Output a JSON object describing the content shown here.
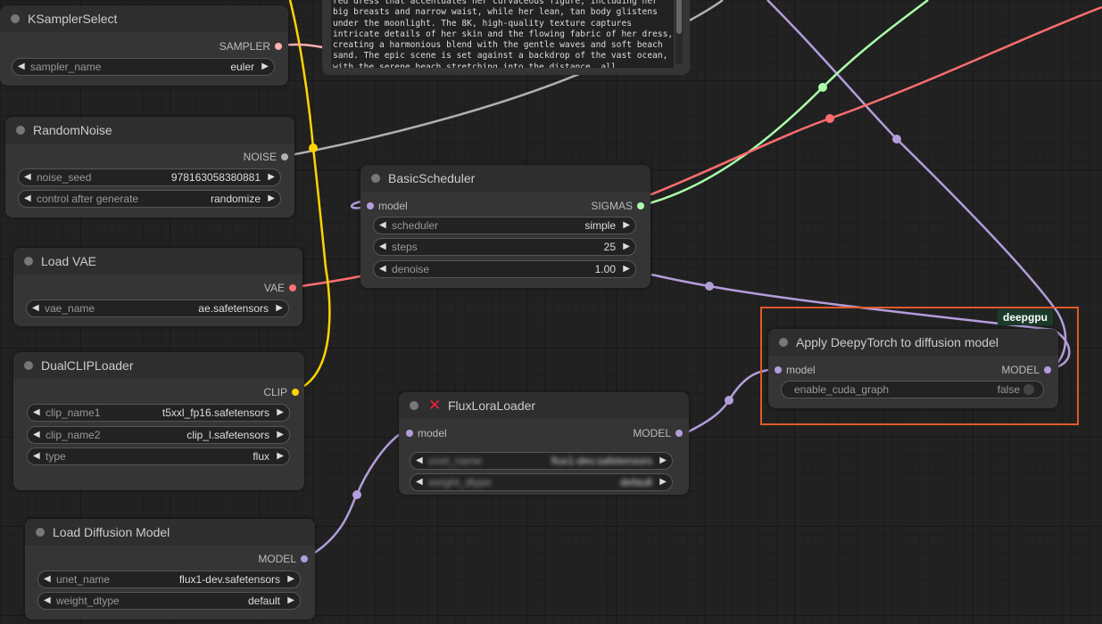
{
  "prompt_text": "red dress that accentuates her curvaceous figure, including her big breasts and narrow waist, while her lean, tan body glistens under the moonlight. The 8K, high-quality texture captures intricate details of her skin and the flowing fabric of her dress, creating a harmonious blend with the gentle waves and soft beach sand. The epic scene is set against a backdrop of the vast ocean, with the serene beach stretching into the distance, all",
  "colors": {
    "clip": "#ffd500",
    "vae": "#ff6e6e",
    "model": "#b39ddb",
    "sigmas": "#aaffaa",
    "noise": "#b0b0b0",
    "sampler": "#ffb0b0",
    "highlight": "#e05a2b"
  },
  "badge": "deepgpu",
  "nodes": {
    "ksampler_select": {
      "title": "KSamplerSelect",
      "output": "SAMPLER",
      "widgets": [
        {
          "label": "sampler_name",
          "value": "euler"
        }
      ]
    },
    "random_noise": {
      "title": "RandomNoise",
      "output": "NOISE",
      "widgets": [
        {
          "label": "noise_seed",
          "value": "978163058380881"
        },
        {
          "label": "control after generate",
          "value": "randomize"
        }
      ]
    },
    "load_vae": {
      "title": "Load VAE",
      "output": "VAE",
      "widgets": [
        {
          "label": "vae_name",
          "value": "ae.safetensors"
        }
      ]
    },
    "dual_clip_loader": {
      "title": "DualCLIPLoader",
      "output": "CLIP",
      "widgets": [
        {
          "label": "clip_name1",
          "value": "t5xxl_fp16.safetensors"
        },
        {
          "label": "clip_name2",
          "value": "clip_l.safetensors"
        },
        {
          "label": "type",
          "value": "flux"
        }
      ]
    },
    "load_diffusion_model": {
      "title": "Load Diffusion Model",
      "output": "MODEL",
      "widgets": [
        {
          "label": "unet_name",
          "value": "flux1-dev.safetensors"
        },
        {
          "label": "weight_dtype",
          "value": "default"
        }
      ]
    },
    "basic_scheduler": {
      "title": "BasicScheduler",
      "input": "model",
      "output": "SIGMAS",
      "widgets": [
        {
          "label": "scheduler",
          "value": "simple"
        },
        {
          "label": "steps",
          "value": "25"
        },
        {
          "label": "denoise",
          "value": "1.00"
        }
      ]
    },
    "flux_lora_loader": {
      "title": "FluxLoraLoader",
      "input": "model",
      "output": "MODEL",
      "widgets": [
        {
          "label": "unet_name",
          "value": "flux1-dev.safetensors"
        },
        {
          "label": "weight_dtype",
          "value": "default"
        }
      ]
    },
    "apply_deepytorch": {
      "title": "Apply DeepyTorch to diffusion model",
      "input": "model",
      "output": "MODEL",
      "widgets": [
        {
          "label": "enable_cuda_graph",
          "value": "false"
        }
      ]
    }
  }
}
